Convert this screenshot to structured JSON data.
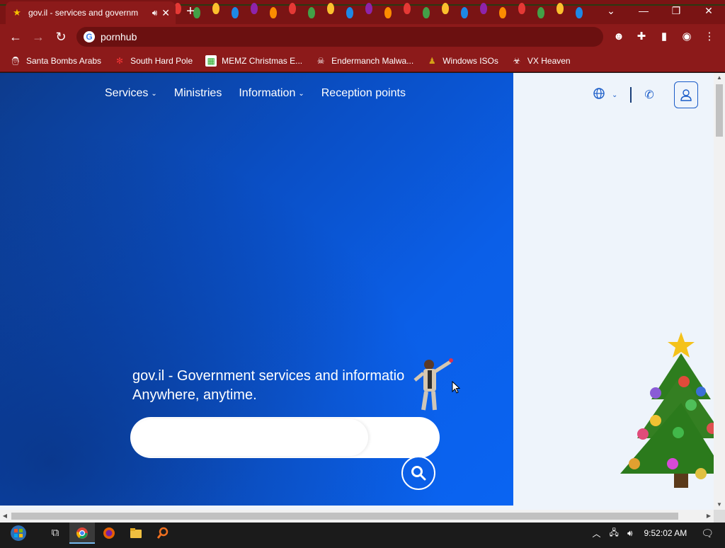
{
  "browser": {
    "tab_title": "gov.il - services and governm",
    "address": "pornhub",
    "bookmarks": [
      {
        "label": "Santa Bombs Arabs",
        "icon": "santa-icon"
      },
      {
        "label": "South Hard Pole",
        "icon": "snowflake-icon"
      },
      {
        "label": "MEMZ Christmas E...",
        "icon": "memz-icon"
      },
      {
        "label": "Endermanch Malwa...",
        "icon": "skull-icon"
      },
      {
        "label": "Windows ISOs",
        "icon": "windows-icon"
      },
      {
        "label": "VX Heaven",
        "icon": "vx-icon"
      }
    ]
  },
  "site": {
    "nav": [
      {
        "label": "Services",
        "dropdown": true
      },
      {
        "label": "Ministries",
        "dropdown": false
      },
      {
        "label": "Information",
        "dropdown": true
      },
      {
        "label": "Reception points",
        "dropdown": false
      }
    ],
    "headline_line1": "gov.il - Government services and informatio",
    "headline_line2": "Anywhere, anytime.",
    "search_placeholder": ""
  },
  "taskbar": {
    "time": "9:52:02 AM",
    "apps": [
      "task-view-icon",
      "chrome-icon",
      "firefox-icon",
      "explorer-icon",
      "search-app-icon"
    ]
  },
  "colors": {
    "chrome_red": "#8c1a1a",
    "hero_blue": "#0b5fe8",
    "accent_blue": "#1a5cc8"
  }
}
